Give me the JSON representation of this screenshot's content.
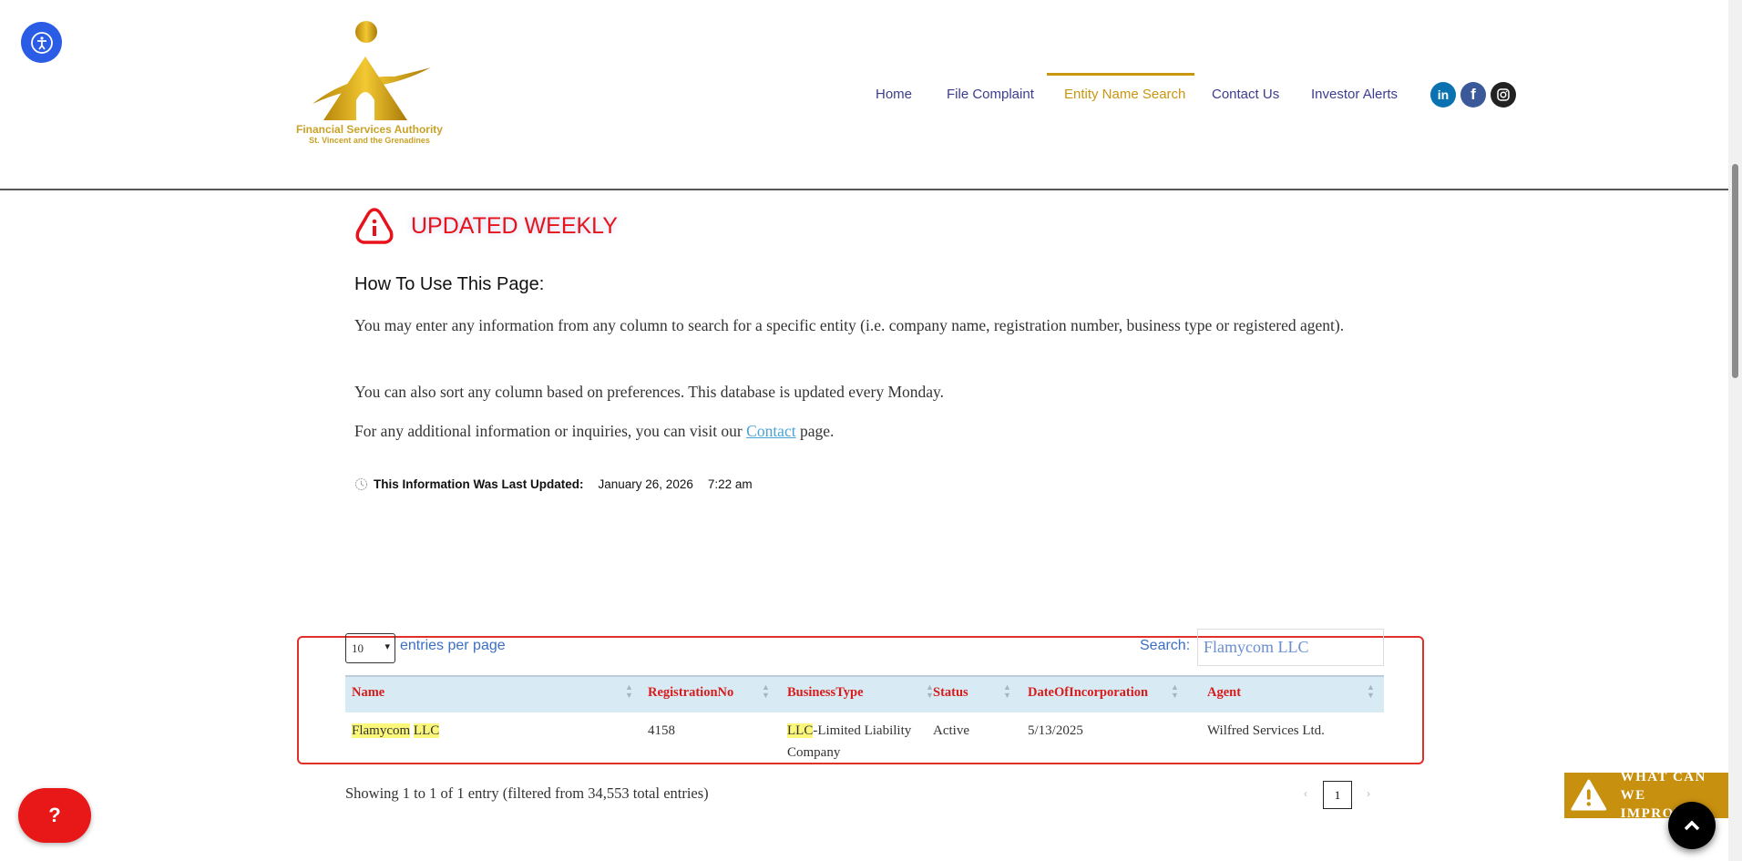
{
  "logo": {
    "line1": "Financial Services Authority",
    "line2": "St. Vincent and the Grenadines"
  },
  "nav": {
    "items": [
      {
        "label": "Home"
      },
      {
        "label": "File Complaint"
      },
      {
        "label": "Entity Name Search",
        "active": true
      },
      {
        "label": "Contact Us"
      },
      {
        "label": "Investor Alerts"
      }
    ]
  },
  "social": {
    "linkedin": "in",
    "facebook": "f"
  },
  "notice": {
    "title": "UPDATED WEEKLY"
  },
  "howto": {
    "heading": "How To Use This Page:",
    "p1": "You may enter any information from any column to search for a specific entity (i.e. company name, registration number, business type or registered agent).",
    "p2": "You can also sort any column based on preferences. This database is updated every Monday.",
    "p3_before": "For any additional information or inquiries, you can visit our ",
    "p3_link": "Contact",
    "p3_after": " page."
  },
  "last_updated": {
    "label": "This Information Was Last Updated:",
    "date": "January 26, 2026",
    "time": "7:22 am"
  },
  "table": {
    "page_size": "10",
    "entries_label": "entries per page",
    "search_label": "Search:",
    "search_value": "Flamycom LLC",
    "columns": [
      "Name",
      "RegistrationNo",
      "BusinessType",
      "Status",
      "DateOfIncorporation",
      "Agent"
    ],
    "rows": [
      {
        "name_a": "Flamycom",
        "name_b": "LLC",
        "reg": "4158",
        "type_hl": "LLC",
        "type_rest": "-Limited Liability",
        "type_line2": "Company",
        "status": "Active",
        "date": "5/13/2025",
        "agent": "Wilfred Services Ltd."
      }
    ],
    "info": "Showing 1 to 1 of 1 entry (filtered from 34,553 total entries)",
    "prev": "‹",
    "page": "1",
    "next": "›"
  },
  "widgets": {
    "help": "?",
    "improve_1": "WHAT CAN",
    "improve_2": "WE IMPROVE?"
  },
  "colors": {
    "gold": "#c8960f",
    "red": "#e8131a",
    "nav": "#3d3d8f"
  }
}
